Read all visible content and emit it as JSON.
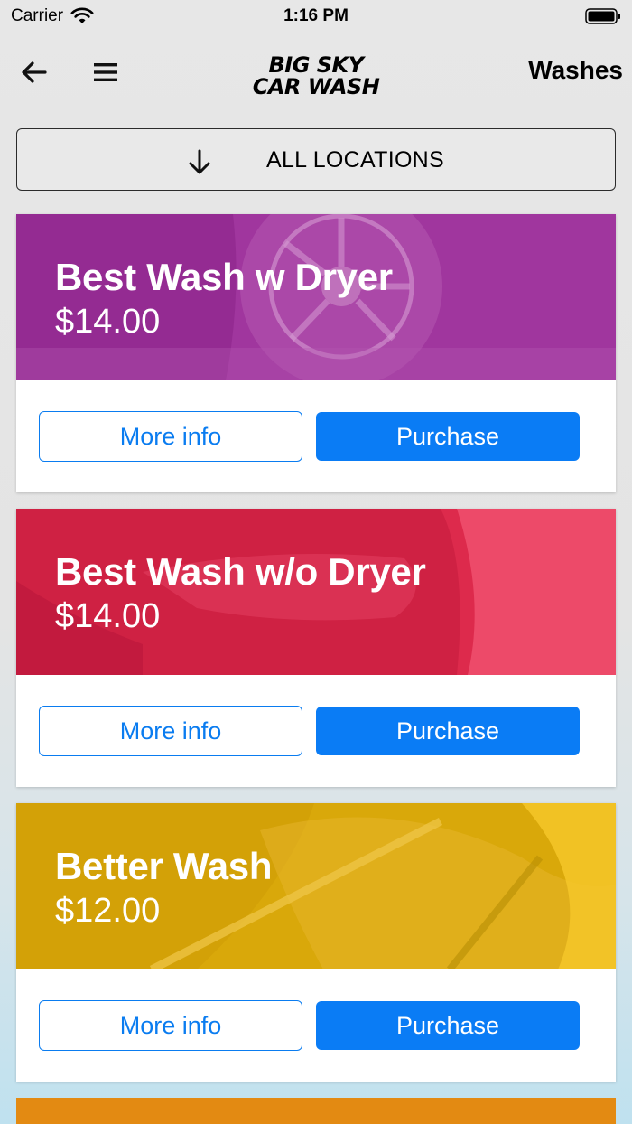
{
  "status_bar": {
    "carrier": "Carrier",
    "time": "1:16 PM"
  },
  "header": {
    "logo_line1": "BIG SKY",
    "logo_line2": "CAR WASH",
    "title": "Washes",
    "back_icon": "arrow-left-icon",
    "menu_icon": "hamburger-menu-icon"
  },
  "location": {
    "label": "ALL LOCATIONS",
    "icon": "arrow-down-icon"
  },
  "buttons": {
    "more_info": "More info",
    "purchase": "Purchase"
  },
  "washes": [
    {
      "name": "Best Wash w Dryer",
      "price": "$14.00",
      "color": "#a0369e"
    },
    {
      "name": "Best Wash w/o Dryer",
      "price": "$14.00",
      "color": "#dd2a4c"
    },
    {
      "name": "Better Wash",
      "price": "$12.00",
      "color": "#d9a80a"
    }
  ],
  "next_card_color": "#e38a12",
  "colors": {
    "accent": "#0a7cf5"
  }
}
